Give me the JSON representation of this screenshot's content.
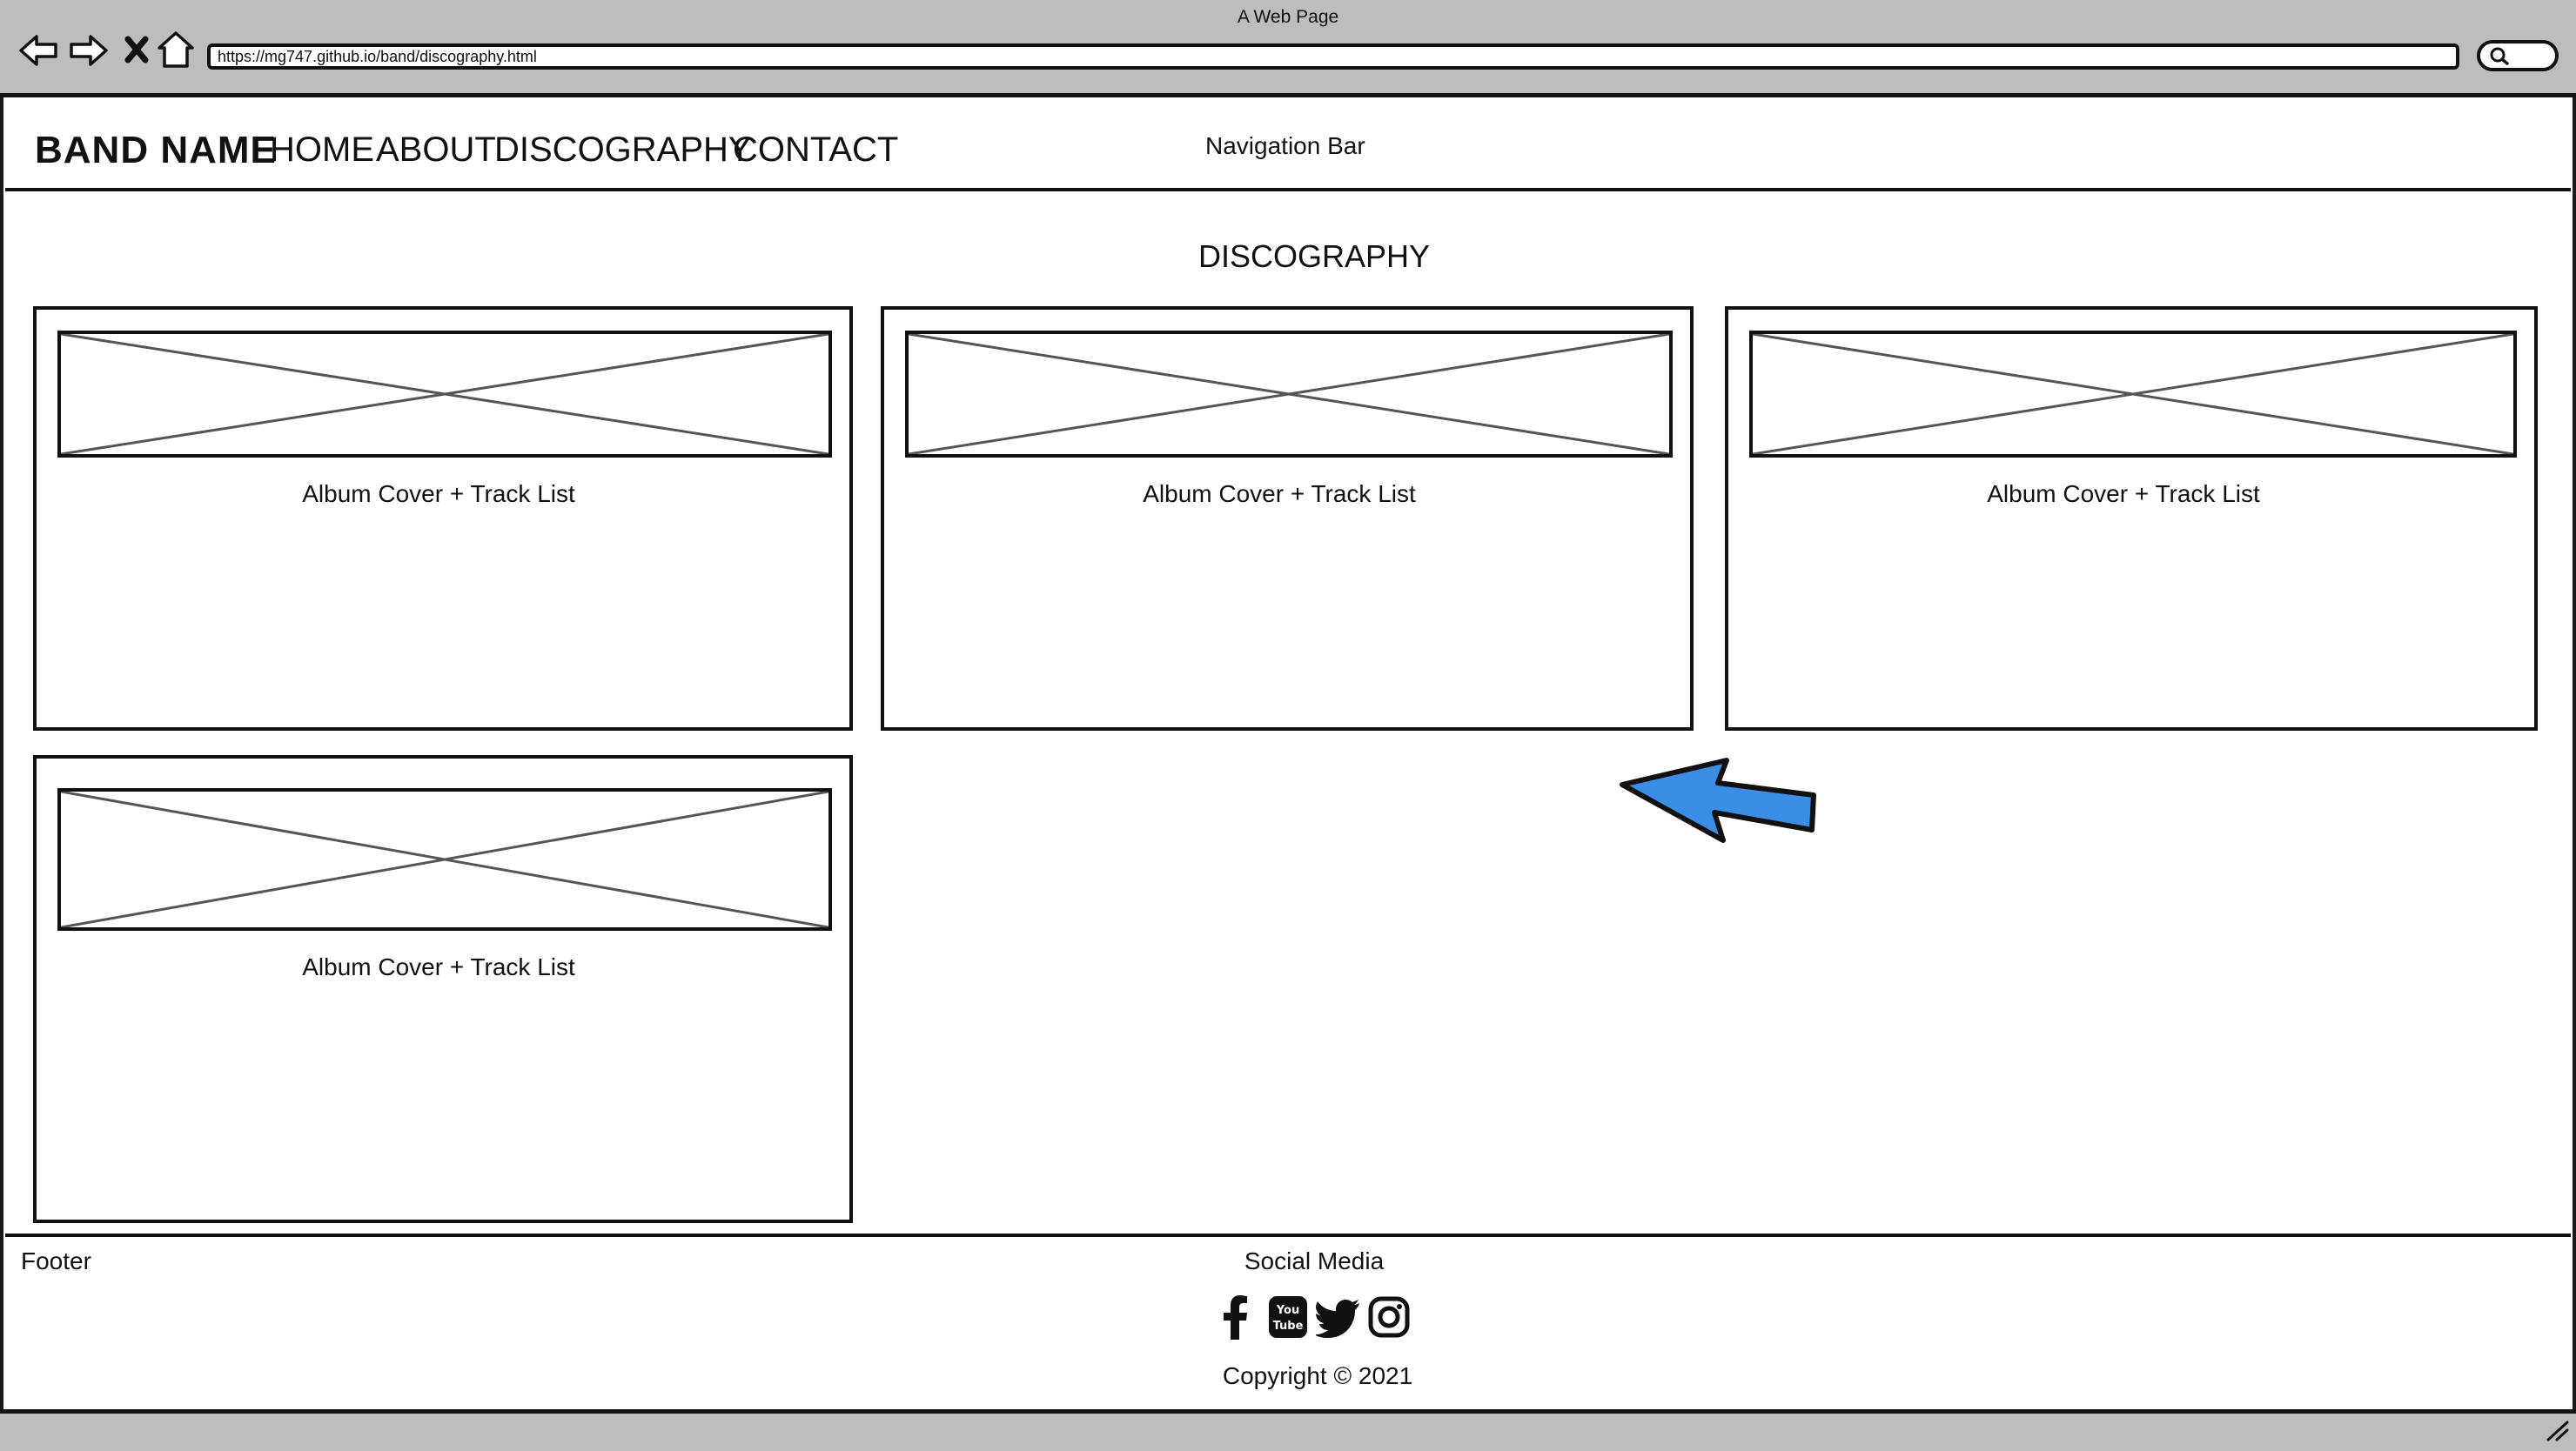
{
  "browser": {
    "title": "A Web Page",
    "url": "https://mg747.github.io/band/discography.html"
  },
  "header": {
    "brand": "BAND NAME",
    "nav": [
      "HOME",
      "ABOUT",
      "DISCOGRAPHY",
      "CONTACT"
    ],
    "note": "Navigation Bar"
  },
  "main": {
    "title": "DISCOGRAPHY",
    "cards": [
      {
        "label": "Album Cover + Track List"
      },
      {
        "label": "Album Cover + Track List"
      },
      {
        "label": "Album Cover + Track List"
      },
      {
        "label": "Album Cover + Track List"
      }
    ]
  },
  "footer": {
    "label": "Footer",
    "social_title": "Social Media",
    "social_icons": [
      "facebook-icon",
      "youtube-icon",
      "twitter-icon",
      "instagram-icon"
    ],
    "copyright": "Copyright © 2021"
  },
  "colors": {
    "chrome": "#bdbdbd",
    "arrow": "#3a8ee6",
    "ink": "#111111"
  }
}
